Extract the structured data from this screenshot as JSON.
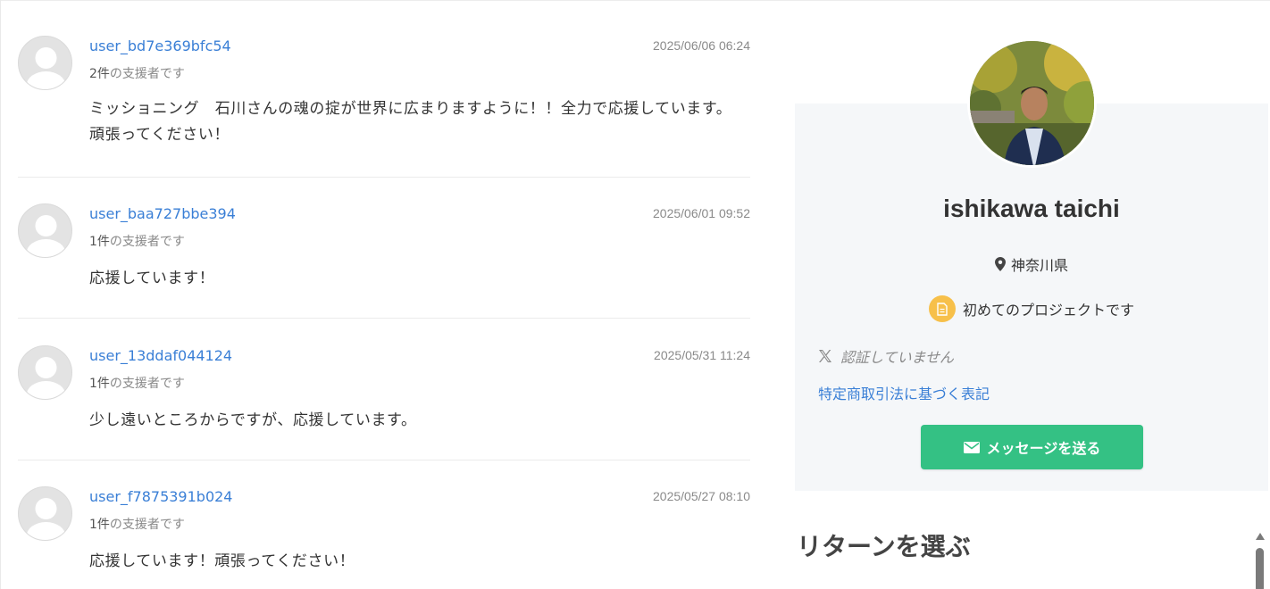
{
  "comments": [
    {
      "user": "user_bd7e369bfc54",
      "timestamp": "2025/06/06 06:24",
      "count": "2件",
      "count_suffix": "の支援者です",
      "text": "ミッショニング　石川さんの魂の掟が世界に広まりますように！！全力で応援しています。頑張ってください！"
    },
    {
      "user": "user_baa727bbe394",
      "timestamp": "2025/06/01 09:52",
      "count": "1件",
      "count_suffix": "の支援者です",
      "text": "応援しています！"
    },
    {
      "user": "user_13ddaf044124",
      "timestamp": "2025/05/31 11:24",
      "count": "1件",
      "count_suffix": "の支援者です",
      "text": "少し遠いところからですが、応援しています。"
    },
    {
      "user": "user_f7875391b024",
      "timestamp": "2025/05/27 08:10",
      "count": "1件",
      "count_suffix": "の支援者です",
      "text": "応援しています！頑張ってください！"
    }
  ],
  "profile": {
    "name": "ishikawa taichi",
    "location": "神奈川県",
    "first_project": "初めてのプロジェクトです",
    "x_status": "認証していません",
    "law_link": "特定商取引法に基づく表記",
    "message_button": "メッセージを送る"
  },
  "returns_title": "リターンを選ぶ",
  "colors": {
    "link": "#3a7fd6",
    "button": "#34c184",
    "badge": "#f7c04a",
    "card": "#f5f7f9"
  },
  "icons": {
    "location": "map-pin-icon",
    "badge": "document-icon",
    "x": "x-logo-icon",
    "message": "envelope-icon",
    "scroll": "scroll-up-arrow-icon"
  }
}
